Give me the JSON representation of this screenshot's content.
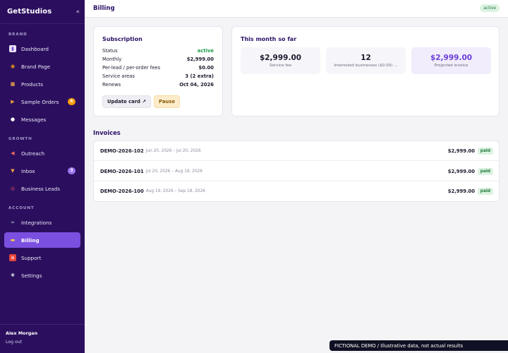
{
  "app": {
    "name": "GetStudios",
    "collapse_icon": "double-chevron-left"
  },
  "sidebar": {
    "sections": [
      {
        "label": "BRAND"
      },
      {
        "label": "GROWTH"
      },
      {
        "label": "ACCOUNT"
      }
    ],
    "items": [
      {
        "label": "Dashboard",
        "icon": "chart-icon",
        "glyph": "▮"
      },
      {
        "label": "Brand Page",
        "icon": "palette-icon",
        "glyph": "◉"
      },
      {
        "label": "Products",
        "icon": "box-icon",
        "glyph": "■"
      },
      {
        "label": "Sample Orders",
        "icon": "truck-icon",
        "glyph": "▶",
        "badge": "6"
      },
      {
        "label": "Messages",
        "icon": "chat-icon",
        "glyph": "●"
      },
      {
        "label": "Outreach",
        "icon": "megaphone-icon",
        "glyph": "◀"
      },
      {
        "label": "Inbox",
        "icon": "inbox-icon",
        "glyph": "▼",
        "badge": "3"
      },
      {
        "label": "Business Leads",
        "icon": "target-icon",
        "glyph": "◎"
      },
      {
        "label": "Integrations",
        "icon": "link-icon",
        "glyph": "∞"
      },
      {
        "label": "Billing",
        "icon": "credit-card-icon",
        "glyph": "▬",
        "active": true
      },
      {
        "label": "Support",
        "icon": "sos-icon",
        "glyph": "⊕"
      },
      {
        "label": "Settings",
        "icon": "gear-icon",
        "glyph": "✺"
      }
    ],
    "user": {
      "name": "Alex Morgan",
      "logout": "Log out"
    }
  },
  "header": {
    "title": "Billing",
    "status": "active"
  },
  "subscription": {
    "title": "Subscription",
    "rows": [
      {
        "label": "Status",
        "value": "active"
      },
      {
        "label": "Monthly",
        "value": "$2,999.00"
      },
      {
        "label": "Per-lead / per-order fees",
        "value": "$0.00"
      },
      {
        "label": "Service areas",
        "value": "3 (2 extra)"
      },
      {
        "label": "Renews",
        "value": "Oct 04, 2026"
      }
    ],
    "update_button": "Update card ↗",
    "pause_button": "Pause"
  },
  "month": {
    "title": "This month so far",
    "stats": [
      {
        "value": "$2,999.00",
        "label": "Service fee"
      },
      {
        "value": "12",
        "label": "Interested businesses ($0.00) …"
      },
      {
        "value": "$2,999.00",
        "label": "Projected invoice"
      }
    ]
  },
  "invoices": {
    "title": "Invoices",
    "rows": [
      {
        "id": "DEMO-2026-102",
        "period": "Jun 20, 2026 – Jul 20, 2026",
        "amount": "$2,999.00",
        "status": "paid"
      },
      {
        "id": "DEMO-2026-101",
        "period": "Jul 20, 2026 – Aug 19, 2026",
        "amount": "$2,999.00",
        "status": "paid"
      },
      {
        "id": "DEMO-2026-100",
        "period": "Aug 19, 2026 – Sep 18, 2026",
        "amount": "$2,999.00",
        "status": "paid"
      }
    ]
  },
  "demo_notice": "FICTIONAL DEMO  /  Illustrative data, not actual results",
  "colors": {
    "sidebar": "#2b0f5e",
    "accent": "#7b4fe0",
    "success": "#1f9b4a",
    "warning": "#f59e0b"
  }
}
